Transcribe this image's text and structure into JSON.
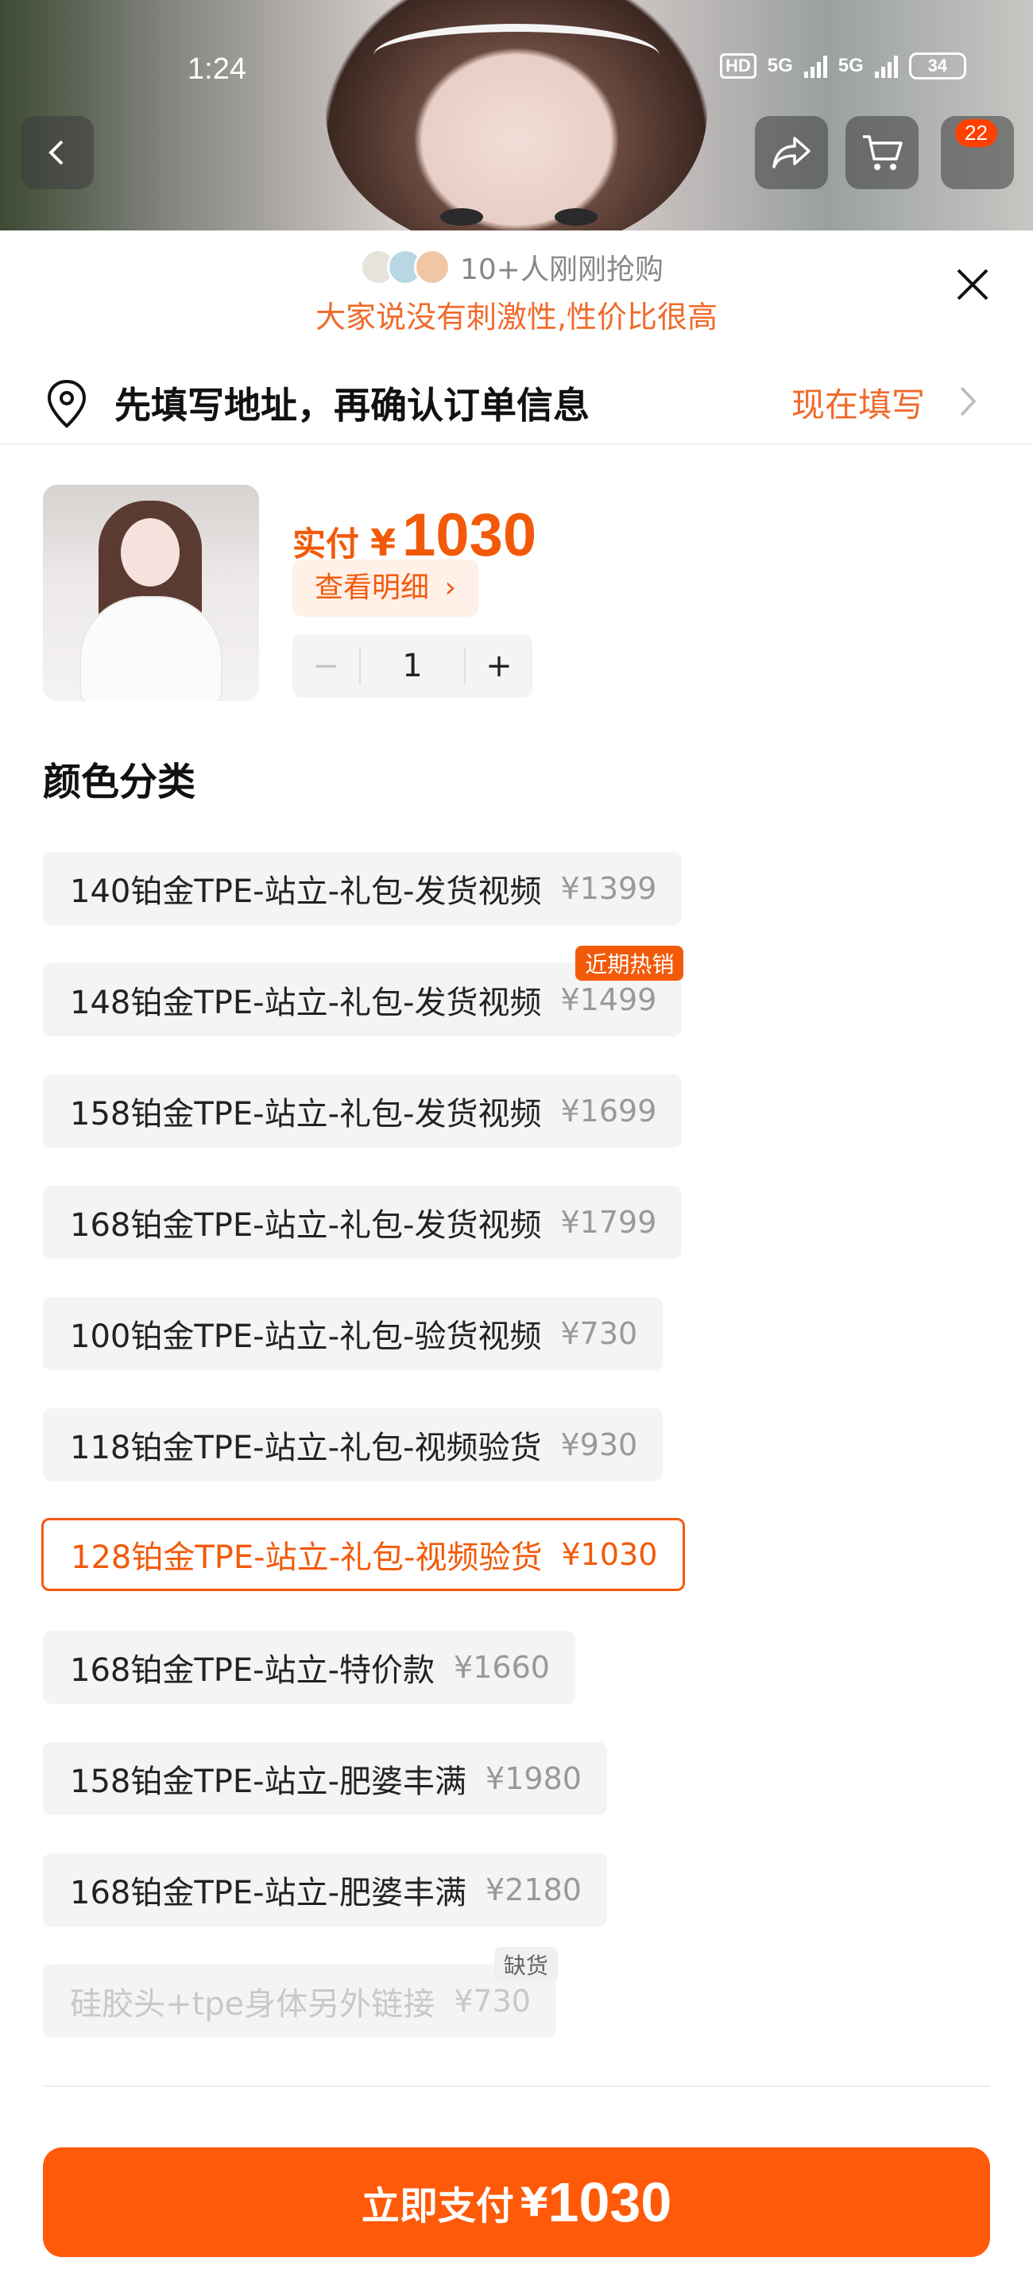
{
  "status_bar": {
    "time": "1:24",
    "network_hd": "HD",
    "network_1": "5G",
    "network_2": "5G",
    "battery": "34"
  },
  "top_bar": {
    "cart_badge": "22"
  },
  "promo": {
    "count_text": "10+人刚刚抢购",
    "review_text": "大家说没有刺激性,性价比很高"
  },
  "address": {
    "prompt": "先填写地址，再确认订单信息",
    "action": "现在填写"
  },
  "order": {
    "paid_label": "实付",
    "currency": "¥",
    "amount": "1030",
    "detail_button": "查看明细",
    "quantity": "1",
    "minus": "−",
    "plus": "+"
  },
  "color_section": {
    "title": "颜色分类",
    "options": [
      {
        "name": "140铂金TPE-站立-礼包-发货视频",
        "price": "¥1399"
      },
      {
        "name": "148铂金TPE-站立-礼包-发货视频",
        "price": "¥1499",
        "badge": "近期热销"
      },
      {
        "name": "158铂金TPE-站立-礼包-发货视频",
        "price": "¥1699"
      },
      {
        "name": "168铂金TPE-站立-礼包-发货视频",
        "price": "¥1799"
      },
      {
        "name": "100铂金TPE-站立-礼包-验货视频",
        "price": "¥730"
      },
      {
        "name": "118铂金TPE-站立-礼包-视频验货",
        "price": "¥930"
      },
      {
        "name": "128铂金TPE-站立-礼包-视频验货",
        "price": "¥1030",
        "selected": true
      },
      {
        "name": "168铂金TPE-站立-特价款",
        "price": "¥1660"
      },
      {
        "name": "158铂金TPE-站立-肥婆丰满",
        "price": "¥1980"
      },
      {
        "name": "168铂金TPE-站立-肥婆丰满",
        "price": "¥2180"
      },
      {
        "name": "硅胶头+tpe身体另外链接",
        "price": "¥730",
        "badge": "缺货",
        "disabled": true
      }
    ]
  },
  "pay": {
    "label": "立即支付",
    "currency": "¥",
    "amount": "1030"
  },
  "colors": {
    "accent": "#f25a0a",
    "pay_button": "#ff5a0a",
    "promo_text": "#f06a2a"
  }
}
